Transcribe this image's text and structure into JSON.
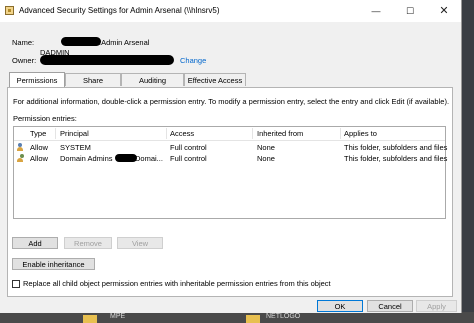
{
  "window": {
    "title": "Advanced Security Settings for Admin Arsenal (\\\\hlnsrv5)",
    "min_symbol": "—",
    "max_symbol": "☐",
    "close_symbol": "✕"
  },
  "owner_section": {
    "name_label": "Name:",
    "name_value_visible": ".Admin Arsenal",
    "owner_label": "Owner:",
    "owner_value_visible": "DADMIN",
    "change_link": "Change"
  },
  "tabs": [
    {
      "label": "Permissions",
      "active": true
    },
    {
      "label": "Share",
      "active": false
    },
    {
      "label": "Auditing",
      "active": false
    },
    {
      "label": "Effective Access",
      "active": false
    }
  ],
  "permissions": {
    "info_text": "For additional information, double-click a permission entry. To modify a permission entry, select the entry and click Edit (if available).",
    "entries_label": "Permission entries:",
    "columns": [
      "Type",
      "Principal",
      "Access",
      "Inherited from",
      "Applies to"
    ],
    "rows": [
      {
        "type": "Allow",
        "principal": "SYSTEM",
        "access": "Full control",
        "inherited_from": "None",
        "applies_to": "This folder, subfolders and files"
      },
      {
        "type": "Allow",
        "principal": "Domain Admins",
        "principal_suffix": "Domai...",
        "access": "Full control",
        "inherited_from": "None",
        "applies_to": "This folder, subfolders and files"
      }
    ]
  },
  "buttons": {
    "add": "Add",
    "remove": "Remove",
    "view": "View",
    "enable_inheritance": "Enable inheritance",
    "ok": "OK",
    "cancel": "Cancel",
    "apply": "Apply"
  },
  "replace_checkbox": {
    "label": "Replace all child object permission entries with inheritable permission entries from this object",
    "checked": false
  },
  "background": {
    "taskbar_labels": [
      "MPE",
      "NETLOGO"
    ]
  },
  "colors": {
    "link": "#0066cc",
    "primary_border": "#0078d7"
  }
}
